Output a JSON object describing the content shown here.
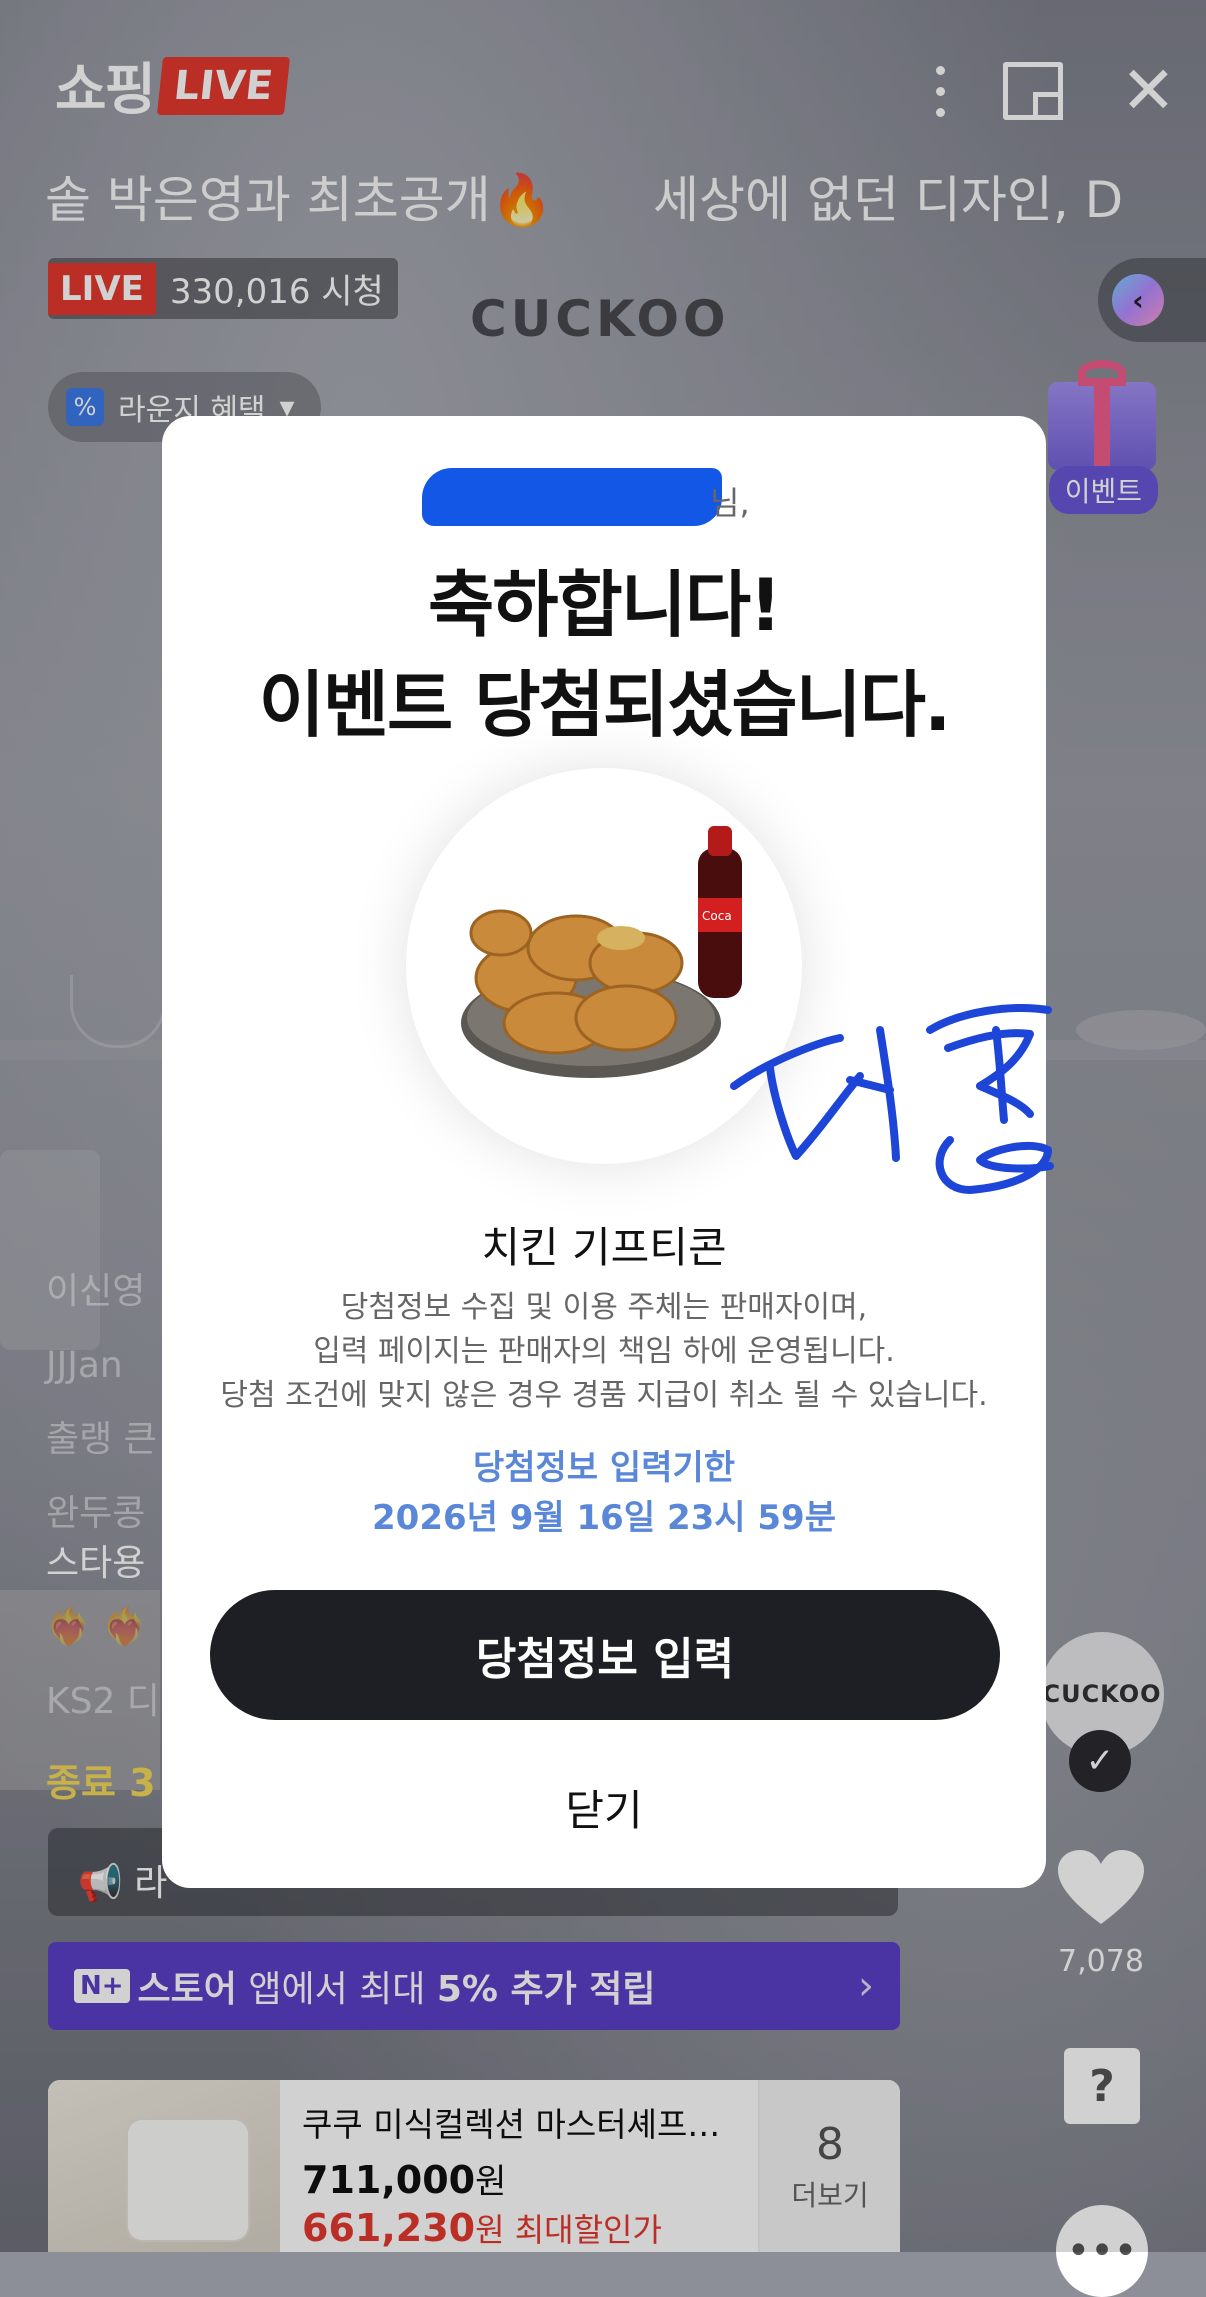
{
  "header": {
    "logo_text": "쇼핑",
    "logo_badge": "LIVE",
    "ticker": [
      "솥 박은영과 최초공개🔥",
      "세상에 없던 디자인, D"
    ],
    "live_badge": "LIVE",
    "viewer_count": "330,016 시청",
    "brand_watermark": "CUCKOO",
    "lounge_label": "라운지 혜택",
    "lounge_icon": "%",
    "event_label": "이벤트"
  },
  "chat": {
    "lines": [
      "이신영",
      "JJJan",
      "출랭 큰",
      "완두콩",
      "스타용",
      "❤️‍🔥 ❤️‍🔥",
      "KS2 디"
    ],
    "ends_text": "종료 3"
  },
  "notice": {
    "text": "라"
  },
  "nplus": {
    "badge": "N+",
    "store": "스토어",
    "text_mid": " 앱에서 최대 ",
    "highlight": "5% 추가 적립"
  },
  "product": {
    "name": "쿠쿠 미식컬렉션 마스터셰프…",
    "price": "711,000",
    "price_unit": "원",
    "sale_price": "661,230",
    "sale_suffix": "원 최대할인가",
    "more_count": "8",
    "more_label": "더보기"
  },
  "side": {
    "brand": "CUCKOO",
    "like_count": "7,078",
    "q_icon": "?",
    "more_icon": "•••"
  },
  "modal": {
    "nim": "님,",
    "title1": "축하합니다!",
    "title2": "이벤트 당첨되셨습니다.",
    "prize_name": "치킨 기프티콘",
    "disclaimer_1": "당첨정보 수집 및 이용 주체는 판매자이며,",
    "disclaimer_2": "입력 페이지는 판매자의 책임 하에 운영됩니다.",
    "disclaimer_3": "당첨 조건에 맞지 않은 경우 경품 지급이 취소 될 수 있습니다.",
    "deadline_label": "당첨정보 입력기한",
    "deadline_date": "2026년 9월 16일 23시 59분",
    "enter_button": "당첨정보 입력",
    "close_button": "닫기"
  },
  "colors": {
    "live_red": "#e5392e",
    "deadline_blue": "#5a87d8",
    "nplus_purple": "#5b3fc7",
    "button_dark": "#1e1f24"
  }
}
